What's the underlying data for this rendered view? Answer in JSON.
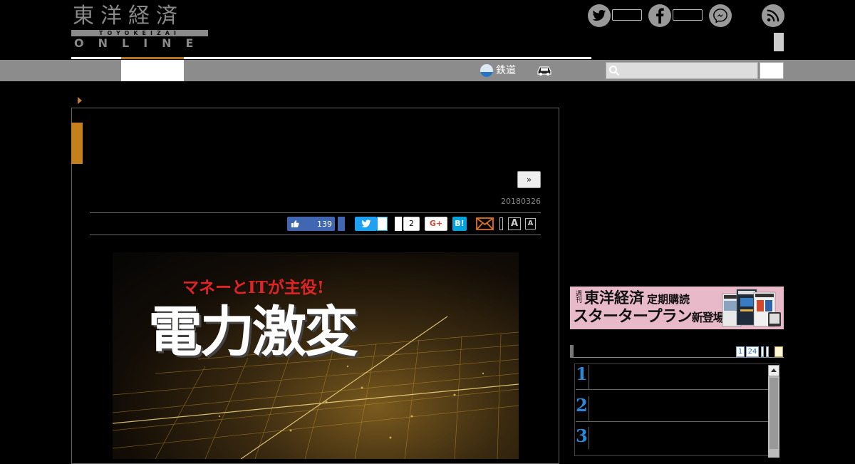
{
  "header": {
    "logo": {
      "kanji": "東洋経済",
      "roman": "TOYOKEIZAI",
      "online": "ONLINE"
    },
    "social": [
      "twitter-icon",
      "facebook-icon",
      "messenger-icon",
      "rss-icon"
    ]
  },
  "nav": {
    "rail_label": "鉄道",
    "search": {
      "placeholder": ""
    }
  },
  "article": {
    "next_label": "»",
    "date": "20180326",
    "share": {
      "fb_like_count": "139",
      "hatena_count": "2",
      "gplus_label": "G+",
      "hatena_label": "B!",
      "font_large": "A",
      "font_small": "A"
    },
    "cover": {
      "kicker": "マネーとITが主役!",
      "title": "電力激変"
    }
  },
  "sidebar": {
    "banner": {
      "weekly": "週刊",
      "brand": "東洋経済",
      "sub": "定期購読",
      "plan": "スタータープラン",
      "new": "新登場!"
    },
    "ranking": {
      "tabs": [
        "1",
        "24"
      ],
      "numbers": [
        "1",
        "2",
        "3"
      ]
    }
  },
  "colors": {
    "accent_orange": "#c5801e",
    "nav_gray": "#8c8c8c",
    "facebook": "#4267b2",
    "twitter": "#1da1f2",
    "hatena": "#00a4de",
    "rank_blue": "#2a8ad8"
  }
}
